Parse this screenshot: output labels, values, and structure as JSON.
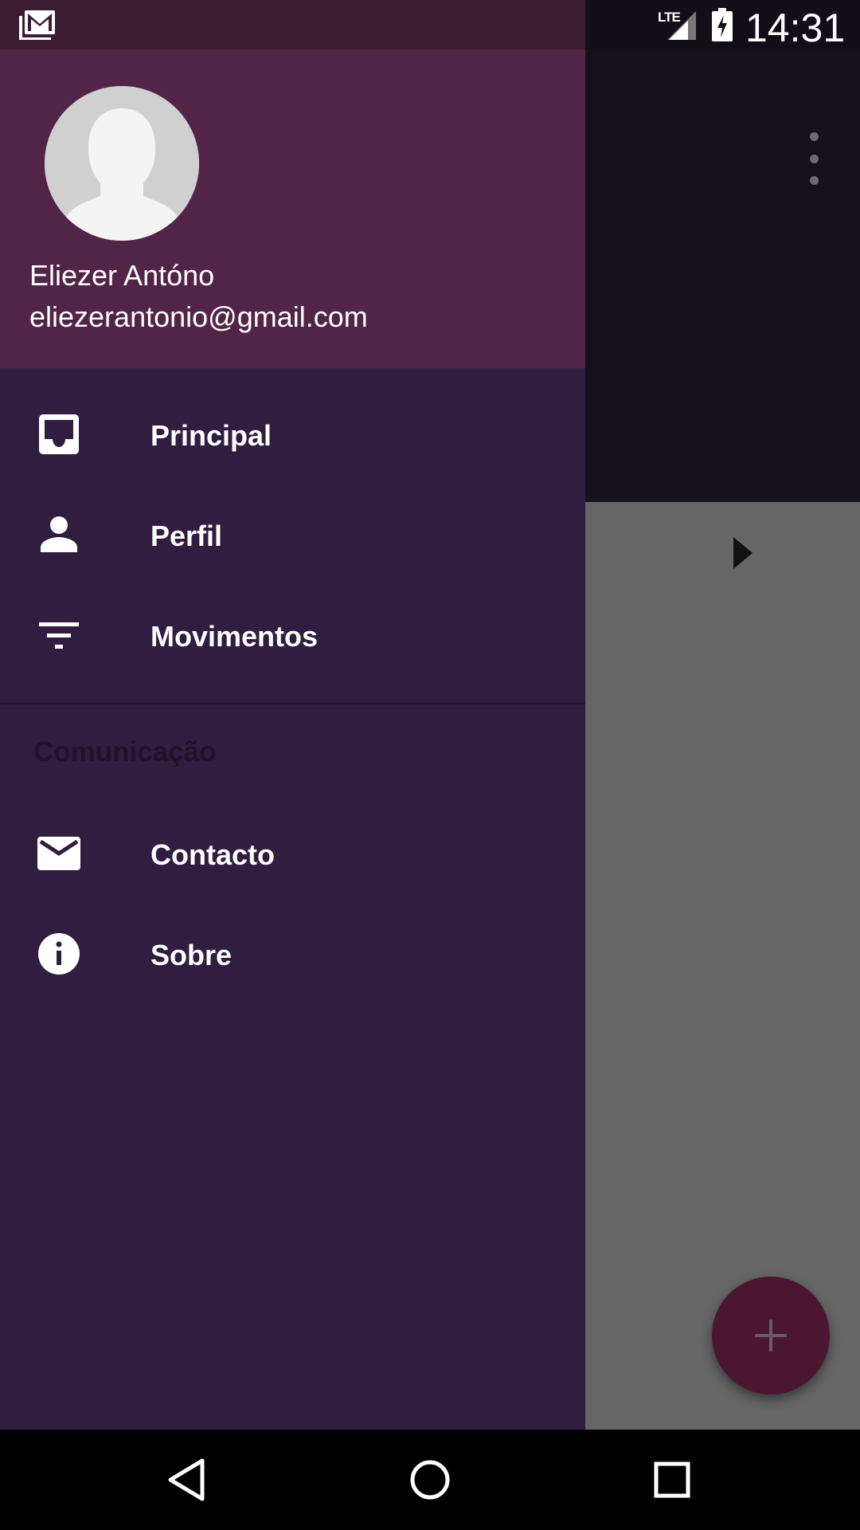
{
  "status_bar": {
    "time": "14:31",
    "network": "LTE",
    "notification_icon": "gmail-icon",
    "signal_icon": "signal-icon",
    "battery_icon": "battery-charging-icon"
  },
  "drawer": {
    "header": {
      "name": "Eliezer Antóno",
      "email": "eliezerantonio@gmail.com",
      "avatar_icon": "avatar-placeholder"
    },
    "items": [
      {
        "label": "Principal",
        "icon": "inbox-icon"
      },
      {
        "label": "Perfil",
        "icon": "person-icon"
      },
      {
        "label": "Movimentos",
        "icon": "filter-icon"
      }
    ],
    "section_title": "Comunicação",
    "section_items": [
      {
        "label": "Contacto",
        "icon": "mail-icon"
      },
      {
        "label": "Sobre",
        "icon": "info-icon"
      }
    ]
  },
  "app": {
    "fab_icon": "plus-icon",
    "overflow_icon": "more-vert-icon",
    "arrow_icon": "arrow-right-icon"
  },
  "colors": {
    "drawer_bg": "#301d3f",
    "header_bg": "#522548",
    "status_bar": "#3c1c33",
    "fab": "#4a1630",
    "scrim_content": "#666666"
  },
  "navigation_bar": [
    "back-icon",
    "home-icon",
    "recents-icon"
  ]
}
